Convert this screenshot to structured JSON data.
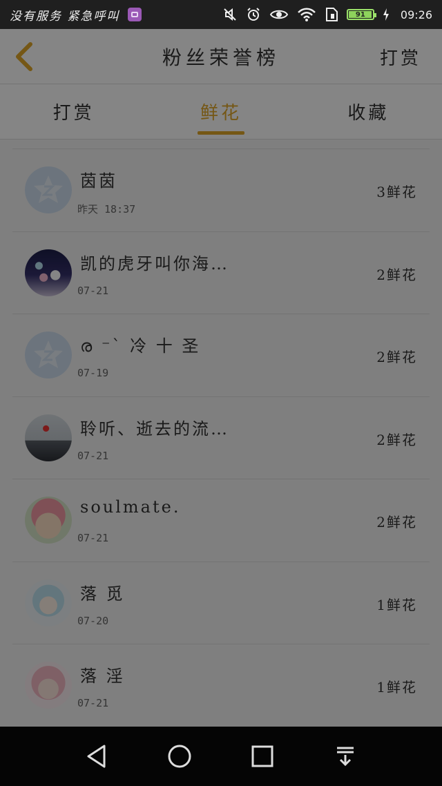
{
  "status_bar": {
    "carrier": "没有服务 紧急呼叫",
    "time": "09:26",
    "battery": {
      "level": 91,
      "label": "91"
    },
    "icons": [
      "gallery-icon",
      "mute-icon",
      "alarm-icon",
      "eye-icon",
      "wifi-icon",
      "sim-icon",
      "battery-icon",
      "charging-icon"
    ]
  },
  "header": {
    "title": "粉丝荣誉榜",
    "reward_label": "打赏",
    "back_icon": "chevron-left-icon"
  },
  "tabs": [
    {
      "label": "打赏",
      "active": false
    },
    {
      "label": "鲜花",
      "active": true
    },
    {
      "label": "收藏",
      "active": false
    }
  ],
  "list": [
    {
      "name": "茵茵",
      "date": "昨天 18:37",
      "count": "3鲜花",
      "avatar": "default"
    },
    {
      "name": "凯的虎牙叫你海…",
      "date": "07-21",
      "count": "2鲜花",
      "avatar": "photo"
    },
    {
      "name": "ര ⁻` 冷 十 圣",
      "date": "07-19",
      "count": "2鲜花",
      "avatar": "default"
    },
    {
      "name": "聆听、逝去的流…",
      "date": "07-21",
      "count": "2鲜花",
      "avatar": "photo"
    },
    {
      "name": "soulmate.",
      "date": "07-21",
      "count": "2鲜花",
      "avatar": "photo"
    },
    {
      "name": "落 觅",
      "date": "07-20",
      "count": "1鲜花",
      "avatar": "photo"
    },
    {
      "name": "落 淫",
      "date": "07-21",
      "count": "1鲜花",
      "avatar": "photo"
    }
  ],
  "colors": {
    "accent": "#e0a72a",
    "status_bar": "#1f1f1f",
    "nav_bar": "#050505"
  },
  "navbar": {
    "icons": [
      "back-triangle-icon",
      "home-circle-icon",
      "recents-square-icon",
      "notification-pull-icon"
    ]
  }
}
